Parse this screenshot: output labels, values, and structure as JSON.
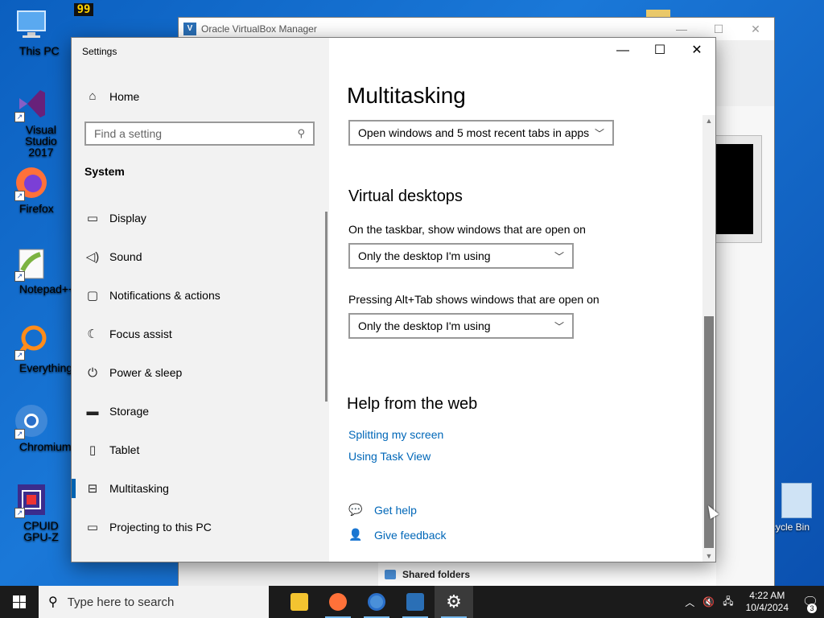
{
  "desktop": {
    "icons": [
      {
        "label": "This PC",
        "icon": "monitor-icon"
      },
      {
        "label": "Visual Studio 2017",
        "icon": "visual-studio-icon"
      },
      {
        "label": "Firefox",
        "icon": "firefox-icon"
      },
      {
        "label": "Notepad++",
        "icon": "notepad-plus-plus-icon"
      },
      {
        "label": "Everything",
        "icon": "everything-search-icon"
      },
      {
        "label": "Chromium",
        "icon": "chromium-icon"
      },
      {
        "label": "CPUID GPU-Z",
        "icon": "gpu-z-icon"
      }
    ],
    "recycle_bin_label": "cycle Bin",
    "top_badge": "99"
  },
  "vbox": {
    "title": "Oracle VirtualBox Manager",
    "shared_folders": "Shared folders"
  },
  "settings": {
    "app_title": "Settings",
    "home_label": "Home",
    "search_placeholder": "Find a setting",
    "section": "System",
    "nav": [
      {
        "label": "Display",
        "icon": "display-icon",
        "glyph": "▭"
      },
      {
        "label": "Sound",
        "icon": "speaker-icon",
        "glyph": "◁)"
      },
      {
        "label": "Notifications & actions",
        "icon": "notification-icon",
        "glyph": "▢"
      },
      {
        "label": "Focus assist",
        "icon": "moon-icon",
        "glyph": "☾"
      },
      {
        "label": "Power & sleep",
        "icon": "power-icon",
        "glyph": "⏻"
      },
      {
        "label": "Storage",
        "icon": "storage-icon",
        "glyph": "▬"
      },
      {
        "label": "Tablet",
        "icon": "tablet-icon",
        "glyph": "▯"
      },
      {
        "label": "Multitasking",
        "icon": "multitasking-icon",
        "glyph": "⊟"
      },
      {
        "label": "Projecting to this PC",
        "icon": "projecting-icon",
        "glyph": "▭"
      }
    ],
    "active_nav": "Multitasking",
    "page_title": "Multitasking",
    "alt_tab_tabs_dropdown": "Open windows and 5 most recent tabs in apps",
    "virtual_desktops_heading": "Virtual desktops",
    "taskbar_label": "On the taskbar, show windows that are open on",
    "taskbar_dropdown": "Only the desktop I'm using",
    "alttab_label": "Pressing Alt+Tab shows windows that are open on",
    "alttab_dropdown": "Only the desktop I'm using",
    "help_heading": "Help from the web",
    "help_links": [
      "Splitting my screen",
      "Using Task View"
    ],
    "get_help": "Get help",
    "give_feedback": "Give feedback"
  },
  "taskbar": {
    "search_placeholder": "Type here to search",
    "apps": [
      {
        "name": "file-explorer",
        "color": "#f4c430"
      },
      {
        "name": "firefox",
        "color": "#ff7139"
      },
      {
        "name": "chromium",
        "color": "#4a90d9"
      },
      {
        "name": "virtualbox",
        "color": "#2a6fb6"
      },
      {
        "name": "settings",
        "color": "#ffffff"
      }
    ],
    "time": "4:22 AM",
    "date": "10/4/2024",
    "notification_count": "3"
  },
  "colors": {
    "accent": "#0063b1",
    "link": "#0067b8"
  }
}
